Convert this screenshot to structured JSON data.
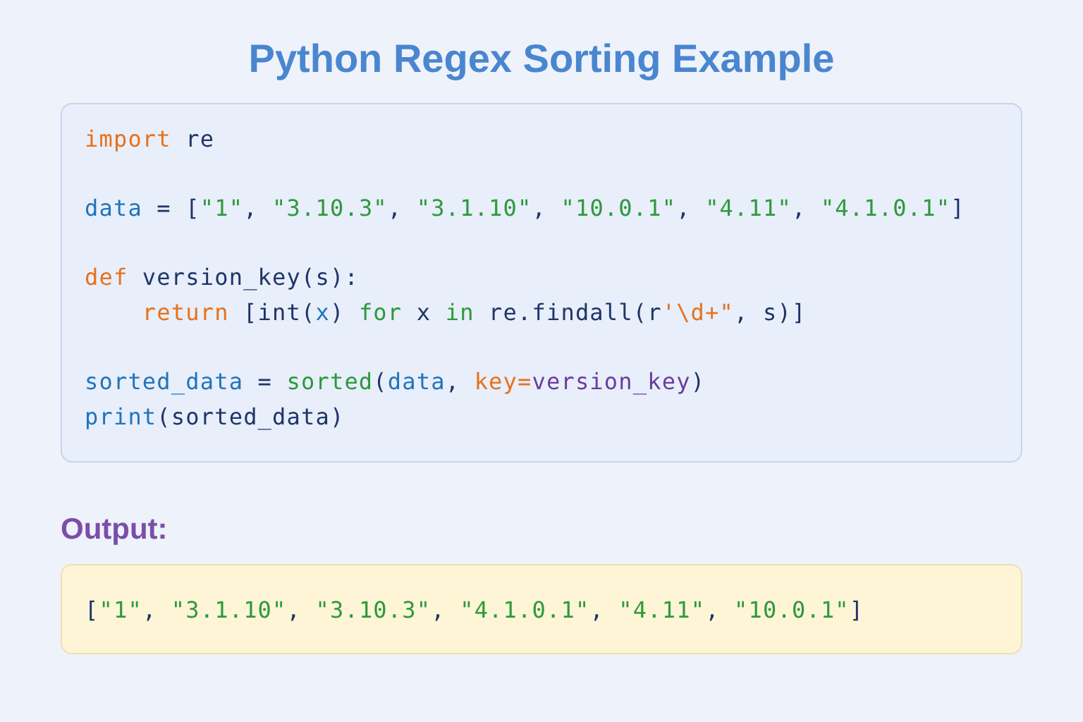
{
  "title": "Python Regex Sorting Example",
  "code_groups": [
    {
      "lines": [
        {
          "tokens": [
            {
              "kind": "keyword",
              "text": "import"
            },
            {
              "kind": "plain",
              "text": " re"
            }
          ]
        }
      ]
    },
    {
      "lines": [
        {
          "tokens": [
            {
              "kind": "variable",
              "text": "data"
            },
            {
              "kind": "plain",
              "text": " = ["
            },
            {
              "kind": "string",
              "text": "\"1\""
            },
            {
              "kind": "plain",
              "text": ", "
            },
            {
              "kind": "string",
              "text": "\"3.10.3\""
            },
            {
              "kind": "plain",
              "text": ", "
            },
            {
              "kind": "string",
              "text": "\"3.1.10\""
            },
            {
              "kind": "plain",
              "text": ", "
            },
            {
              "kind": "string",
              "text": "\"10.0.1\""
            },
            {
              "kind": "plain",
              "text": ", "
            },
            {
              "kind": "string",
              "text": "\"4.11\""
            },
            {
              "kind": "plain",
              "text": ", "
            },
            {
              "kind": "string",
              "text": "\"4.1.0.1\""
            },
            {
              "kind": "plain",
              "text": "]"
            }
          ]
        }
      ]
    },
    {
      "lines": [
        {
          "tokens": [
            {
              "kind": "keyword",
              "text": "def"
            },
            {
              "kind": "plain",
              "text": " version_key(s):"
            }
          ]
        },
        {
          "tokens": [
            {
              "kind": "keyword",
              "text": "    return"
            },
            {
              "kind": "plain",
              "text": " [int("
            },
            {
              "kind": "variable",
              "text": "x"
            },
            {
              "kind": "plain",
              "text": ") "
            },
            {
              "kind": "control",
              "text": "for"
            },
            {
              "kind": "plain",
              "text": " x "
            },
            {
              "kind": "control",
              "text": "in"
            },
            {
              "kind": "plain",
              "text": " re.findall(r"
            },
            {
              "kind": "keyword",
              "text": "'\\d+\""
            },
            {
              "kind": "plain",
              "text": ", s)]"
            }
          ]
        }
      ]
    },
    {
      "lines": [
        {
          "tokens": [
            {
              "kind": "variable",
              "text": "sorted_data"
            },
            {
              "kind": "plain",
              "text": " = "
            },
            {
              "kind": "control",
              "text": "sorted"
            },
            {
              "kind": "plain",
              "text": "("
            },
            {
              "kind": "variable",
              "text": "data"
            },
            {
              "kind": "plain",
              "text": ", "
            },
            {
              "kind": "keyword",
              "text": "key="
            },
            {
              "kind": "param",
              "text": "version_key"
            },
            {
              "kind": "plain",
              "text": ")"
            }
          ]
        },
        {
          "tokens": [
            {
              "kind": "variable",
              "text": "print"
            },
            {
              "kind": "plain",
              "text": "(sorted_data)"
            }
          ]
        }
      ]
    }
  ],
  "output_label": "Output:",
  "output_tokens": [
    {
      "kind": "plain",
      "text": "["
    },
    {
      "kind": "string",
      "text": "\"1\""
    },
    {
      "kind": "plain",
      "text": ", "
    },
    {
      "kind": "string",
      "text": "\"3.1.10\""
    },
    {
      "kind": "plain",
      "text": ", "
    },
    {
      "kind": "string",
      "text": "\"3.10.3\""
    },
    {
      "kind": "plain",
      "text": ", "
    },
    {
      "kind": "string",
      "text": "\"4.1.0.1\""
    },
    {
      "kind": "plain",
      "text": ", "
    },
    {
      "kind": "string",
      "text": "\"4.11\""
    },
    {
      "kind": "plain",
      "text": ", "
    },
    {
      "kind": "string",
      "text": "\"10.0.1\""
    },
    {
      "kind": "plain",
      "text": "]"
    }
  ]
}
